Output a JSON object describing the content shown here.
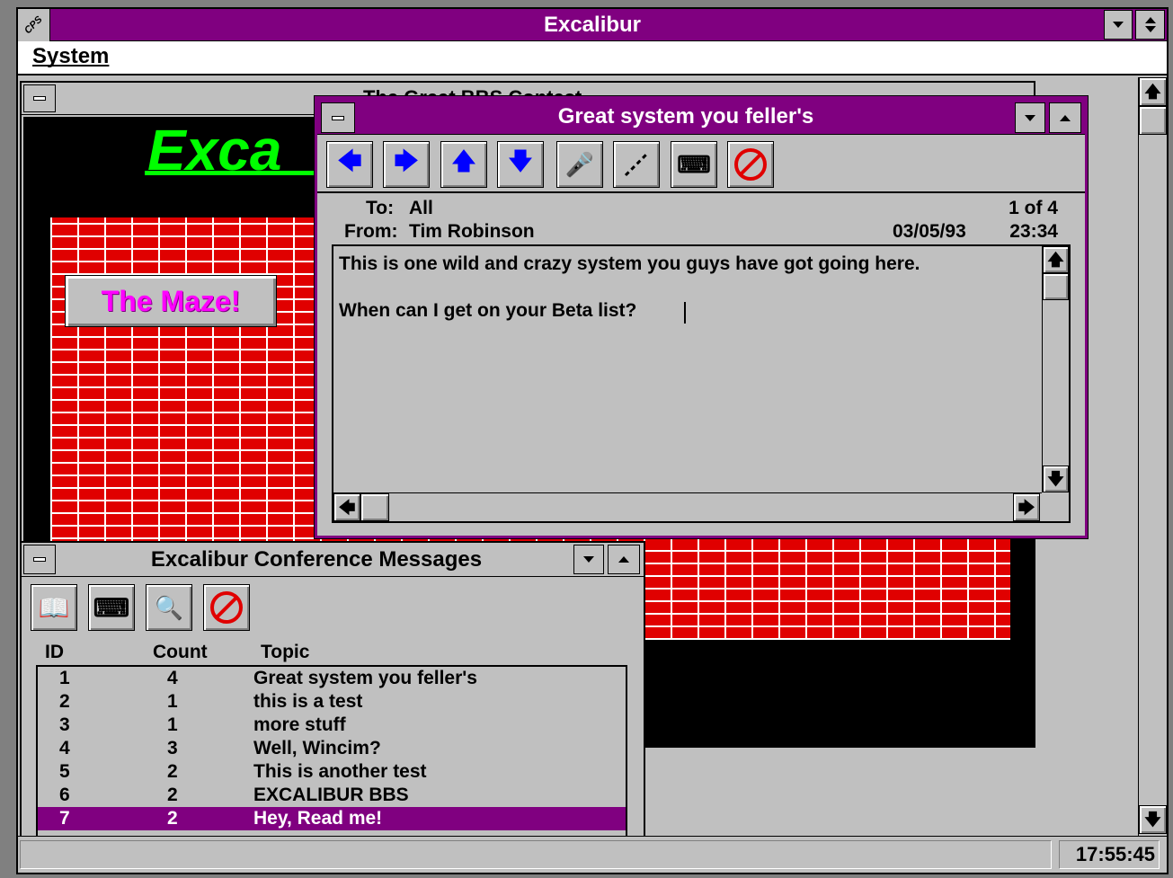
{
  "app": {
    "title": "Excalibur",
    "icon_label": "CPS",
    "menu": [
      "System"
    ],
    "status_time": "17:55:45"
  },
  "bg_window": {
    "title": "The Great BBS Contest",
    "logo_text": "Exca",
    "maze_button": "The Maze!"
  },
  "message_window": {
    "title": "Great system you feller's",
    "toolbar": [
      "prev-arrow-icon",
      "next-arrow-icon",
      "up-arrow-icon",
      "down-arrow-icon",
      "microphone-icon",
      "link-icon",
      "typewriter-icon",
      "cancel-icon"
    ],
    "to_label": "To:",
    "to_value": "All",
    "from_label": "From:",
    "from_value": "Tim Robinson",
    "counter": "1 of 4",
    "date": "03/05/93",
    "time": "23:34",
    "body_line1": "This is one wild and crazy system you guys have got going here.",
    "body_line2": "When can I get on your Beta list?"
  },
  "conf_window": {
    "title": "Excalibur Conference Messages",
    "toolbar": [
      "book-icon",
      "typewriter-icon",
      "search-book-icon",
      "cancel-icon"
    ],
    "columns": [
      "ID",
      "Count",
      "Topic"
    ],
    "rows": [
      {
        "id": "1",
        "count": "4",
        "topic": "Great system you feller's"
      },
      {
        "id": "2",
        "count": "1",
        "topic": "this is a test"
      },
      {
        "id": "3",
        "count": "1",
        "topic": "more stuff"
      },
      {
        "id": "4",
        "count": "3",
        "topic": "Well, Wincim?"
      },
      {
        "id": "5",
        "count": "2",
        "topic": "This is another test"
      },
      {
        "id": "6",
        "count": "2",
        "topic": "EXCALIBUR BBS"
      },
      {
        "id": "7",
        "count": "2",
        "topic": "Hey, Read me!"
      }
    ],
    "selected_row": 7
  },
  "colors": {
    "title_bar": "#800080",
    "face": "#c0c0c0",
    "brick": "#e00000",
    "logo_green": "#00ff00",
    "maze_text": "#ff00ff",
    "selection": "#800080"
  }
}
